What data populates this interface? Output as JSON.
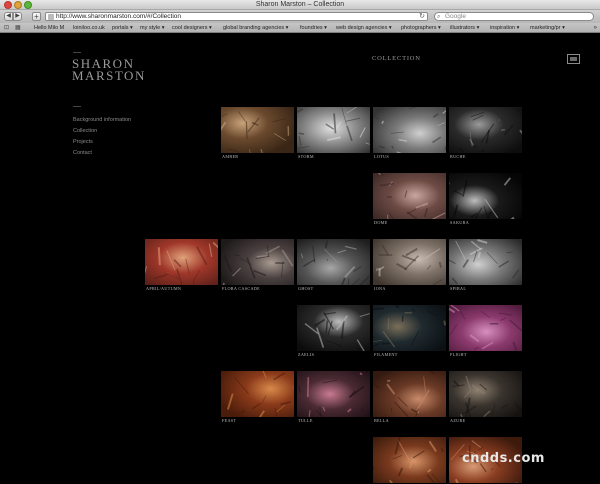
{
  "window": {
    "title": "Sharon Marston – Collection"
  },
  "toolbar": {
    "back": "◀",
    "forward": "▶",
    "add": "+",
    "url": "http://www.sharonmarston.com/#/Collection",
    "reload": "↻",
    "search_placeholder": "Google",
    "search_icon": "⌕"
  },
  "bookmarks": {
    "reading_list": "⊡",
    "topsites": "▦",
    "items": [
      "Hello Milo M",
      "loiniloo.co.uk",
      "portals ▾",
      "my style ▾",
      "cool designers ▾",
      "global branding agencies ▾",
      "foundries ▾",
      "web design agencies ▾",
      "photographers ▾",
      "illustrators ▾",
      "inspiration ▾",
      "marketing/pr ▾"
    ],
    "more": "»"
  },
  "site": {
    "logo_line1": "SHARON",
    "logo_line2": "MARSTON",
    "nav": [
      "Background information",
      "Collection",
      "Projects",
      "Contact"
    ],
    "heading": "COLLECTION"
  },
  "collection": [
    {
      "label": "AMBER",
      "colors": [
        "#6b4a2e",
        "#c9a37a",
        "#3a2616"
      ]
    },
    {
      "label": "STORM",
      "colors": [
        "#8c8c8c",
        "#e0e0e0",
        "#2e2e2e"
      ]
    },
    {
      "label": "LOTUS",
      "colors": [
        "#7a7a7a",
        "#cfcfcf",
        "#333333"
      ]
    },
    {
      "label": "RUCHE",
      "colors": [
        "#2a2a2a",
        "#9a9a9a",
        "#0d0d0d"
      ]
    },
    {
      "label": "DOME",
      "colors": [
        "#6e4b45",
        "#c9a6a0",
        "#3a2724"
      ]
    },
    {
      "label": "SAKURA",
      "colors": [
        "#1a1a1a",
        "#bdbdbd",
        "#050505"
      ]
    },
    {
      "label": "APRIL/AUTUMN",
      "colors": [
        "#a0372a",
        "#e0a27a",
        "#5a1f18"
      ]
    },
    {
      "label": "FLORA CASCADE",
      "colors": [
        "#4a4040",
        "#a89a90",
        "#1f1a1a"
      ]
    },
    {
      "label": "GHOST",
      "colors": [
        "#555555",
        "#a7a7a7",
        "#1e1e1e"
      ]
    },
    {
      "label": "IONA",
      "colors": [
        "#7e7268",
        "#c8bcb2",
        "#3e352e"
      ]
    },
    {
      "label": "SPIRAL",
      "colors": [
        "#7a7a7a",
        "#d0d0d0",
        "#2a2a2a"
      ]
    },
    {
      "label": "ZAELIS",
      "colors": [
        "#2a2a2a",
        "#bcbcbc",
        "#0c0c0c"
      ]
    },
    {
      "label": "FILAMENT",
      "colors": [
        "#1f2a2f",
        "#7a6e5a",
        "#0b1014"
      ]
    },
    {
      "label": "FLIGHT",
      "colors": [
        "#8c3a6e",
        "#d690bf",
        "#4a1838"
      ]
    },
    {
      "label": "FEAST",
      "colors": [
        "#8a3a1a",
        "#d88a4a",
        "#4a1c0a"
      ]
    },
    {
      "label": "TULLE",
      "colors": [
        "#4a2a33",
        "#c87a90",
        "#1c0f14"
      ]
    },
    {
      "label": "BELLA",
      "colors": [
        "#6a3a26",
        "#c98a6a",
        "#33190f"
      ]
    },
    {
      "label": "AZURE",
      "colors": [
        "#3a342e",
        "#8e8070",
        "#151210"
      ]
    },
    {
      "label": "",
      "colors": [
        "#7a3a1e",
        "#d8956a",
        "#3a1a0c"
      ]
    },
    {
      "label": "",
      "colors": [
        "#8a3e22",
        "#d89a74",
        "#3e1a0d"
      ]
    }
  ],
  "watermark": "cndds.com"
}
